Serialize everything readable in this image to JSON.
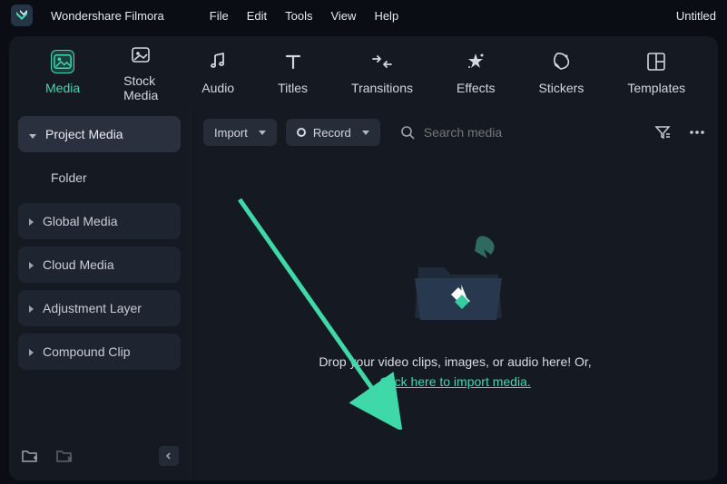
{
  "app": {
    "name": "Wondershare Filmora",
    "document": "Untitled"
  },
  "menu": [
    "File",
    "Edit",
    "Tools",
    "View",
    "Help"
  ],
  "tabs": [
    {
      "label": "Media"
    },
    {
      "label": "Stock Media"
    },
    {
      "label": "Audio"
    },
    {
      "label": "Titles"
    },
    {
      "label": "Transitions"
    },
    {
      "label": "Effects"
    },
    {
      "label": "Stickers"
    },
    {
      "label": "Templates"
    }
  ],
  "sidebar": {
    "items": [
      {
        "label": "Project Media"
      },
      {
        "label": "Folder"
      },
      {
        "label": "Global Media"
      },
      {
        "label": "Cloud Media"
      },
      {
        "label": "Adjustment Layer"
      },
      {
        "label": "Compound Clip"
      }
    ]
  },
  "toolbar": {
    "import_label": "Import",
    "record_label": "Record",
    "search_placeholder": "Search media"
  },
  "dropzone": {
    "text": "Drop your video clips, images, or audio here! Or,",
    "link": "Click here to import media."
  },
  "colors": {
    "accent": "#44d8b2"
  }
}
